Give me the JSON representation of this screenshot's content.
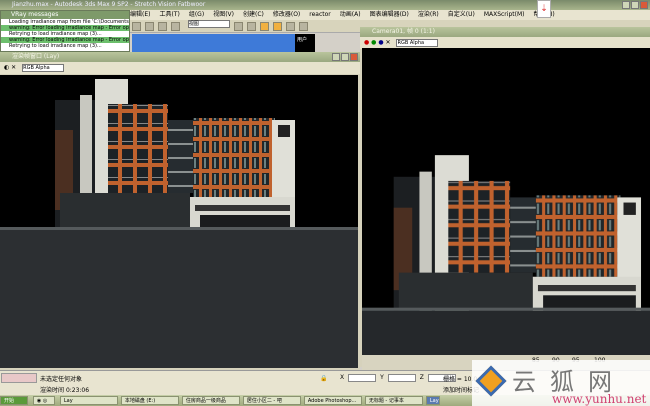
{
  "app": {
    "title": "Jianzhu.max - Autodesk 3ds Max 9 SP2 - Stretch Vision Fatbwoor"
  },
  "menu": [
    "编辑(E)",
    "工具(T)",
    "组(G)",
    "视图(V)",
    "创建(C)",
    "修改器(O)",
    "reactor",
    "动画(A)",
    "图表编辑器(D)",
    "渲染(R)",
    "自定义(U)",
    "MAXScript(M)",
    "帮助(H)"
  ],
  "toolbar": {
    "selection_filter": "视图"
  },
  "vray_messages": {
    "title": "VRay messages",
    "lines": [
      {
        "text": "Loading irradiance map from file 'C:\\Documents and Settings\\...'",
        "type": "info"
      },
      {
        "text": "warning: Error loading irradiance map - Error opening file",
        "type": "warn"
      },
      {
        "text": "Retrying to load irradiance map (3)...",
        "type": "info"
      },
      {
        "text": "warning: Error loading irradiance map - Error opening file",
        "type": "warn"
      },
      {
        "text": "Retrying to load irradiance map (3)...",
        "type": "info"
      }
    ]
  },
  "viewport_label": "用户",
  "left_window": {
    "title": "渲染帧窗口 (Lay)",
    "channel": "RGB Alpha"
  },
  "right_window": {
    "title": "Camera01, 帧 0 (1:1)",
    "channel": "RGB Alpha"
  },
  "status": {
    "prompt": "未选定任何对象",
    "render_time_label": "渲染时间",
    "render_time": "0:23:06",
    "x_label": "X",
    "y_label": "Y",
    "z_label": "Z",
    "grid": "栅格 = 10.0cm",
    "add_time_tag": "添加时间标记",
    "ticks": [
      "85",
      "90",
      "95",
      "100"
    ]
  },
  "taskbar": {
    "start": "开始",
    "items": [
      "Lay",
      "本地磁盘 (E:)",
      "住房商品一级商品",
      "居住小区二 - 吧",
      "Adobe Photoshop...",
      "无标题 - 记事本",
      "Lay"
    ]
  },
  "watermark": {
    "text": "云狐网",
    "url": "www.yunhu.net"
  },
  "colors": {
    "facade_orange": "#c0622e",
    "warn_green": "#6cbf6c",
    "title_green": "#9aa880"
  }
}
